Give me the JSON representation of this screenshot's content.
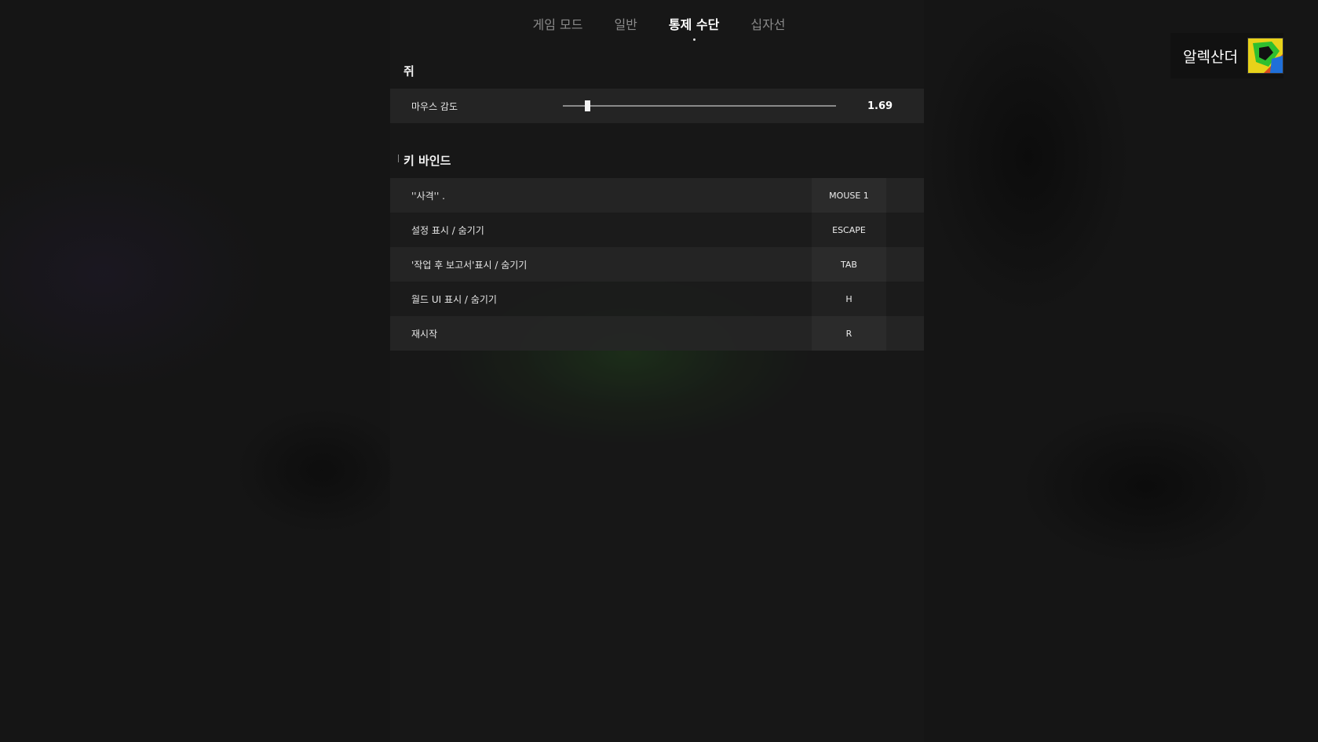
{
  "tabs": [
    {
      "label": "게임 모드",
      "active": false
    },
    {
      "label": "일반",
      "active": false
    },
    {
      "label": "통제 수단",
      "active": true
    },
    {
      "label": "십자선",
      "active": false
    }
  ],
  "user": {
    "name": "알렉산더"
  },
  "mouse_section": {
    "title": "쥐",
    "sensitivity_label": "마우스 감도",
    "sensitivity_value": "1.69",
    "sensitivity_fraction": 0.09
  },
  "keybind_section": {
    "title": "키 바인드",
    "rows": [
      {
        "label": "''사격'' .",
        "key": "MOUSE 1"
      },
      {
        "label": "설정 표시 / 숨기기",
        "key": "ESCAPE"
      },
      {
        "label": "'작업 후 보고서'표시 / 숨기기",
        "key": "TAB"
      },
      {
        "label": "월드 UI 표시 / 숨기기",
        "key": "H"
      },
      {
        "label": "재시작",
        "key": "R"
      }
    ]
  },
  "colors": {
    "accent": "#ffffff",
    "avatar_green": "#2fbf2f",
    "avatar_yellow": "#e8d21a"
  }
}
